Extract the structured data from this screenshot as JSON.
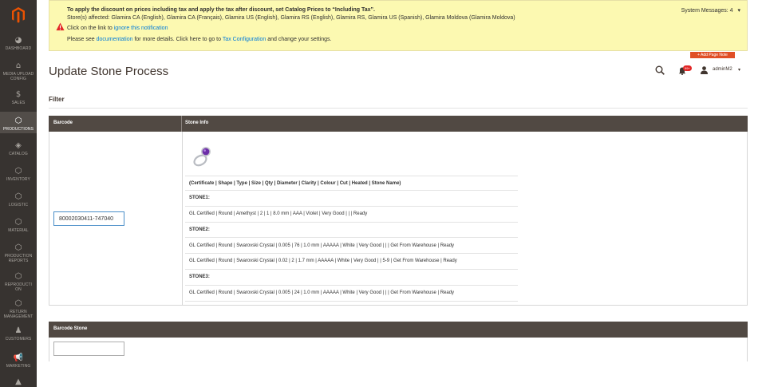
{
  "sidebar": {
    "items": [
      {
        "label": "DASHBOARD",
        "icon": "dashboard-icon"
      },
      {
        "label": "MEDIA UPLOAD CONFIG",
        "icon": "home-icon"
      },
      {
        "label": "SALES",
        "icon": "dollar-icon"
      },
      {
        "label": "PRODUCTIONS",
        "icon": "hexagon-icon",
        "active": true
      },
      {
        "label": "CATALOG",
        "icon": "cube-icon"
      },
      {
        "label": "INVENTORY",
        "icon": "hexagon-icon"
      },
      {
        "label": "LOGISTIC",
        "icon": "hexagon-icon"
      },
      {
        "label": "MATERIAL",
        "icon": "hexagon-icon"
      },
      {
        "label": "PRODUCTION REPORTS",
        "icon": "hexagon-icon"
      },
      {
        "label": "REPRODUCTION",
        "icon": "hexagon-icon"
      },
      {
        "label": "RETURN MANAGEMENT",
        "icon": "hexagon-icon"
      },
      {
        "label": "CUSTOMERS",
        "icon": "person-icon"
      },
      {
        "label": "MARKETING",
        "icon": "megaphone-icon"
      }
    ]
  },
  "notice": {
    "line1": "To apply the discount on prices including tax and apply the tax after discount, set Catalog Prices to “Including Tax”.",
    "line2": "Store(s) affected: Glamira CA (English), Glamira CA (Français), Glamira US (English), Glamira RS (English), Glamira RS, Glamira US (Spanish), Glamira Moldova (Glamira Moldova)",
    "line3_pre": "Click on the link to ",
    "line3_link": "ignore this notification",
    "line4_pre": "Please see ",
    "line4_link1": "documentation",
    "line4_mid": " for more details. Click here to go to ",
    "line4_link2": "Tax Configuration",
    "line4_post": " and change your settings."
  },
  "system_messages": "System Messages: 4",
  "add_page_note": "+ Add Page Note",
  "header": {
    "title": "Update Stone Process",
    "bell_badge": "99+",
    "user": "adminM2"
  },
  "filter_label": "Filter",
  "table": {
    "col_barcode": "Barcode",
    "col_stone_info": "Stone Info",
    "barcode_value": "80002030411-747040",
    "columns_line": "(Certificate | Shape | Type | Size | Qty | Diameter | Clarity | Colour | Cut | Heated | Stone Name)",
    "stone1_label": "STONE1:",
    "stone1_rows": [
      "GL Certified | Round | Amethyst | 2 | 1 | 8.0 mm | AAA | Violet | Very Good | | | Ready"
    ],
    "stone2_label": "STONE2:",
    "stone2_rows": [
      "GL Certified | Round | Swarovski Crystal | 0.005 | 76 | 1.0 mm | AAAAA | White | Very Good | | | Get From Warehouse | Ready",
      "GL Certified | Round | Swarovski Crystal | 0.02 | 2 | 1.7 mm | AAAAA | White | Very Good | | 5-9 | Get From Warehouse | Ready"
    ],
    "stone3_label": "STONE3:",
    "stone3_rows": [
      "GL Certified | Round | Swarovski Crystal | 0.005 | 24 | 1.0 mm | AAAAA | White | Very Good | | | Get From Warehouse | Ready"
    ]
  },
  "barcode_stone": {
    "label": "Barcode Stone",
    "value": ""
  }
}
